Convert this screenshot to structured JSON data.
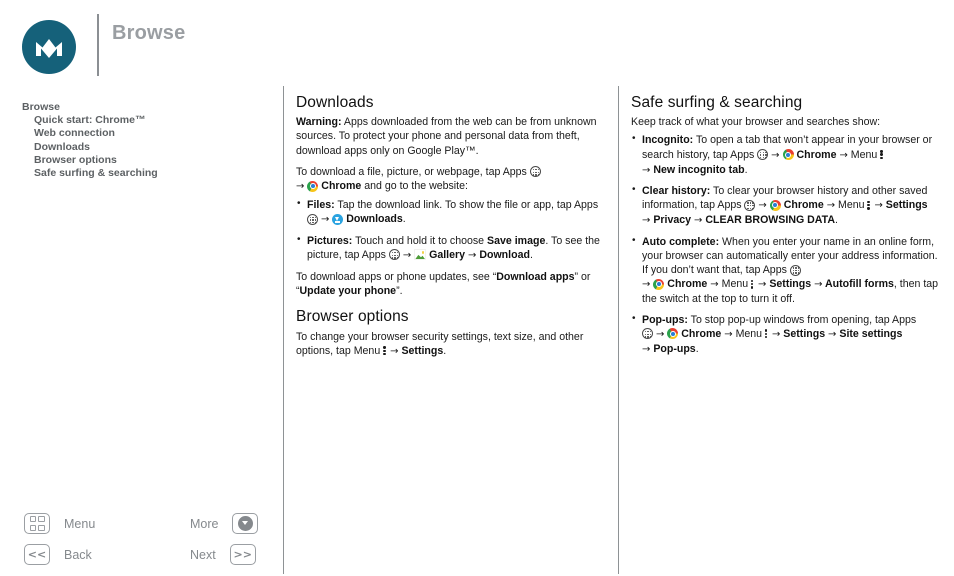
{
  "header": {
    "title": "Browse",
    "logo_name": "motorola-logo",
    "logo_color": "#15617a",
    "title_color": "#9a9ea2"
  },
  "toc": {
    "items": [
      {
        "label": "Browse",
        "sub": false
      },
      {
        "label": "Quick start: Chrome™",
        "sub": true
      },
      {
        "label": "Web connection",
        "sub": true
      },
      {
        "label": "Downloads",
        "sub": true
      },
      {
        "label": "Browser options",
        "sub": true
      },
      {
        "label": "Safe surfing & searching",
        "sub": true
      }
    ]
  },
  "middle": {
    "downloads": {
      "heading": "Downloads",
      "warning_label": "Warning:",
      "warning_text": " Apps downloaded from the web can be from unknown sources. To protect your phone and personal data from theft, download apps only on Google Play™.",
      "intro_a": "To download a file, picture, or webpage, tap Apps ",
      "intro_b": " Chrome",
      "intro_c": " and go to the website:",
      "bullets": [
        {
          "label": "Files:",
          "text_a": " Tap the download link. To show the file or app, tap Apps ",
          "text_b": " Downloads",
          "text_c": "."
        },
        {
          "label": "Pictures:",
          "text_a": " Touch and hold it to choose ",
          "bold_a": "Save image",
          "text_b": ". To see the picture, tap Apps ",
          "bold_b": " Gallery",
          "bold_c": " Download",
          "text_c": "."
        }
      ],
      "outro_a": "To download apps or phone updates, see “",
      "outro_bold_1": "Download apps",
      "outro_b": "” or “",
      "outro_bold_2": "Update your phone",
      "outro_c": "”."
    },
    "browser_options": {
      "heading": "Browser options",
      "text_a": "To change your browser security settings, text size, and other options, tap Menu ",
      "text_bold": " Settings",
      "text_c": "."
    }
  },
  "right": {
    "heading": "Safe surfing & searching",
    "intro": "Keep track of what your browser and searches show:",
    "bullets": [
      {
        "label": "Incognito:",
        "t1": " To open a tab that won’t appear in your browser or search history, tap Apps ",
        "b1": " Chrome",
        "t2": " Menu ",
        "b2": " New incognito tab",
        "t3": "."
      },
      {
        "label": "Clear history:",
        "t1": " To clear your browser history and other saved information, tap Apps ",
        "b1": " Chrome",
        "t2": " Menu ",
        "b2": " Settings",
        "b3": " Privacy",
        "b4": " CLEAR BROWSING DATA",
        "t3": "."
      },
      {
        "label": "Auto complete:",
        "t1": " When you enter your name in an online form, your browser can automatically enter your address information. If you don’t want that, tap Apps ",
        "b1": " Chrome",
        "t2": " Menu ",
        "b2": " Settings",
        "b3": " Autofill forms",
        "t3": ", then tap the switch at the top to turn it off."
      },
      {
        "label": "Pop-ups:",
        "t1": " To stop pop-up windows from opening, tap Apps ",
        "b1": " Chrome",
        "t2": " Menu ",
        "b2": " Settings",
        "b3": " Site settings",
        "b4": " Pop-ups",
        "t3": "."
      }
    ]
  },
  "nav": {
    "menu_label": "Menu",
    "back_label": "Back",
    "more_label": "More",
    "next_label": "Next",
    "back_glyph": "<<",
    "next_glyph": ">>"
  },
  "icons": {
    "apps": "apps-grid-circle-icon",
    "chrome": "chrome-icon",
    "downloads": "downloads-icon",
    "gallery": "gallery-icon",
    "menu_dots": "overflow-menu-icon",
    "arrow": "→"
  },
  "colors": {
    "logo": "#15617a",
    "divider": "#8e9295",
    "muted_text": "#85898d",
    "toc_text": "#5d6164"
  }
}
